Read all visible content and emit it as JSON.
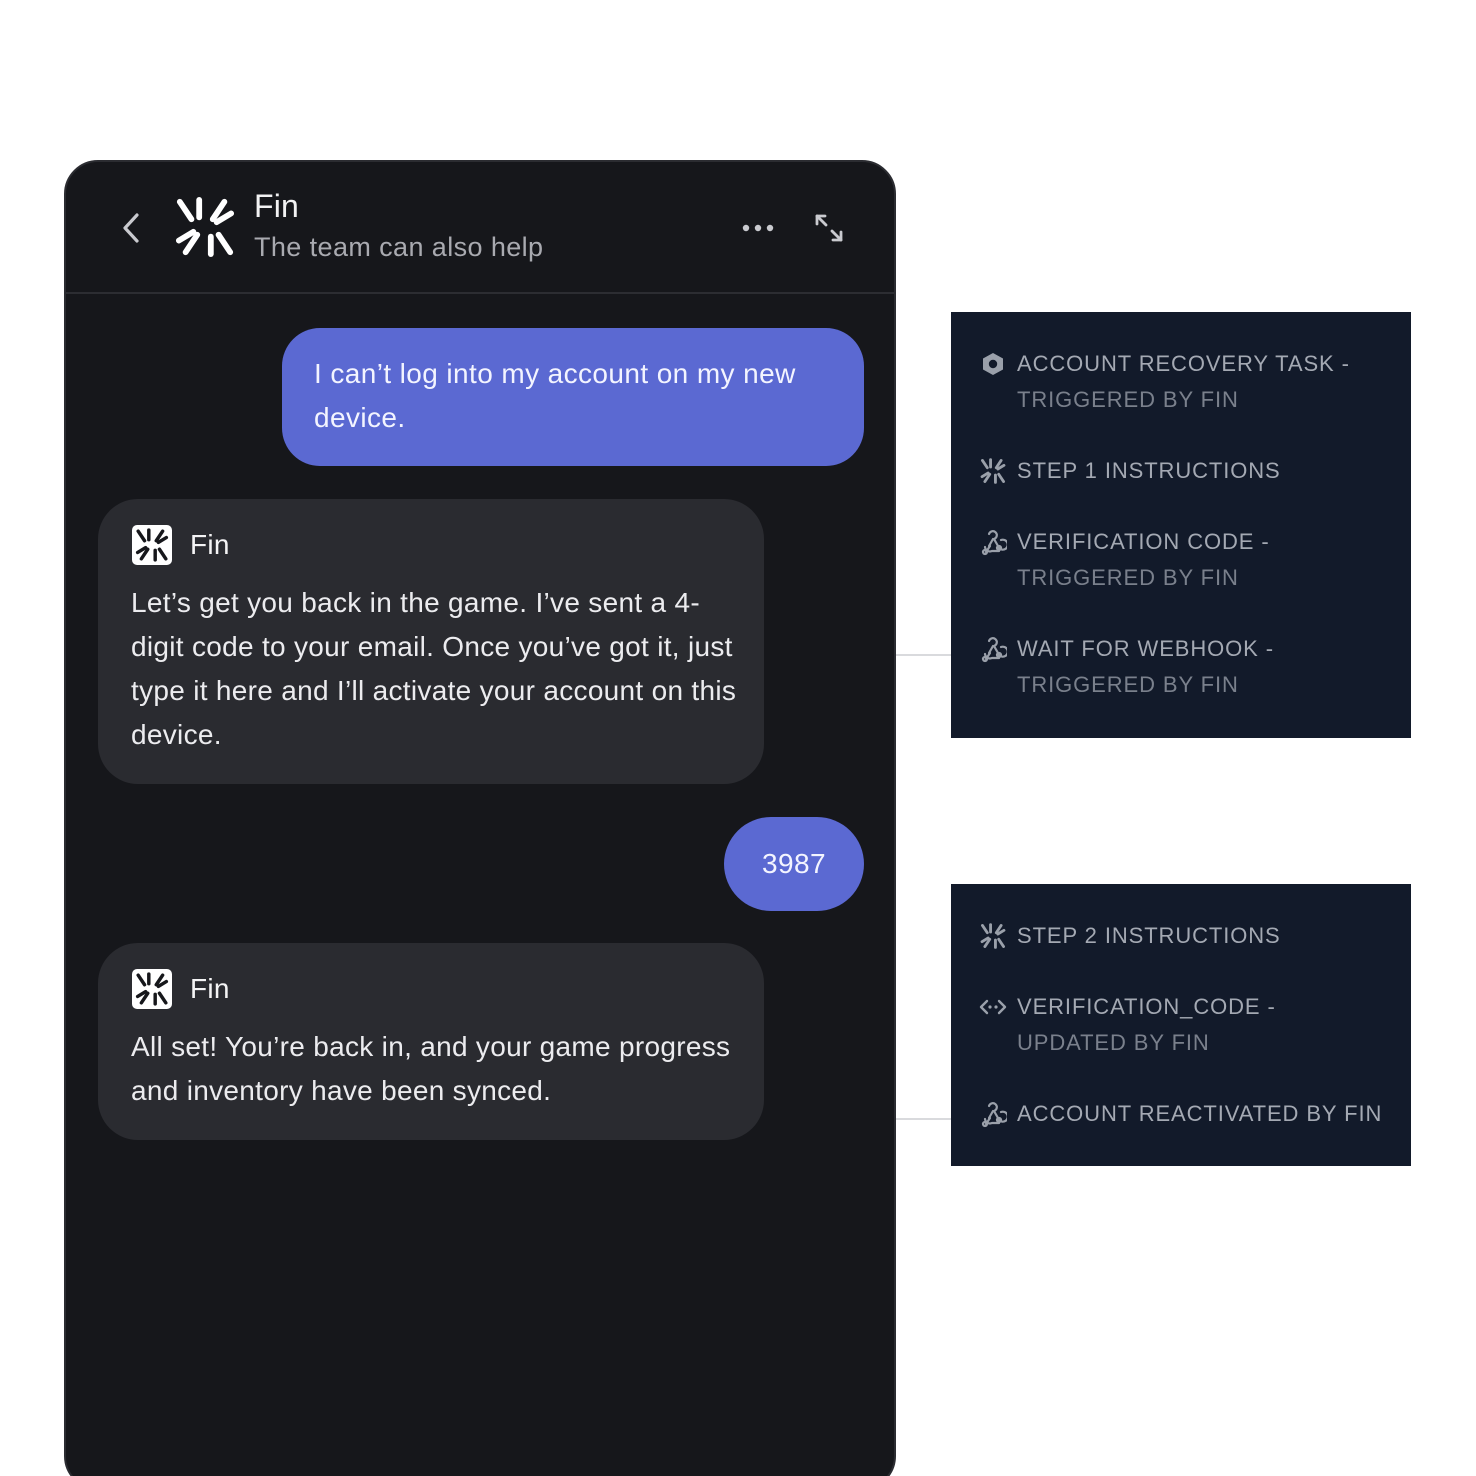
{
  "header": {
    "title": "Fin",
    "subtitle": "The team can also help"
  },
  "messages": [
    {
      "from": "user",
      "text": "I can’t log into my account on my new device."
    },
    {
      "from": "fin",
      "name": "Fin",
      "text": "Let’s get you back in the game. I’ve sent a 4-digit code to your email. Once you’ve got it, just type it here and I’ll activate your account on this device."
    },
    {
      "from": "user",
      "text": "3987"
    },
    {
      "from": "fin",
      "name": "Fin",
      "text": "All set! You’re back in, and your game progress and inventory have been synced."
    }
  ],
  "panels": [
    {
      "events": [
        {
          "icon": "hexagon-icon",
          "line1": "ACCOUNT RECOVERY TASK -",
          "line2": "TRIGGERED BY FIN"
        },
        {
          "icon": "fin-logo-icon",
          "line1": "STEP 1 INSTRUCTIONS"
        },
        {
          "icon": "webhook-icon",
          "line1": "VERIFICATION CODE -",
          "line2": "TRIGGERED BY FIN"
        },
        {
          "icon": "webhook-icon",
          "line1": "WAIT FOR WEBHOOK -",
          "line2": "TRIGGERED BY FIN"
        }
      ]
    },
    {
      "events": [
        {
          "icon": "fin-logo-icon",
          "line1": "STEP 2 INSTRUCTIONS"
        },
        {
          "icon": "code-icon",
          "line1": "VERIFICATION_CODE -",
          "line2": "UPDATED BY FIN"
        },
        {
          "icon": "webhook-icon",
          "line1": "ACCOUNT REACTIVATED BY FIN"
        }
      ]
    }
  ],
  "colors": {
    "chat_bg": "#16171b",
    "user_bubble": "#5b69d2",
    "fin_bubble": "#2a2b30",
    "panel_bg": "#121a2a"
  }
}
